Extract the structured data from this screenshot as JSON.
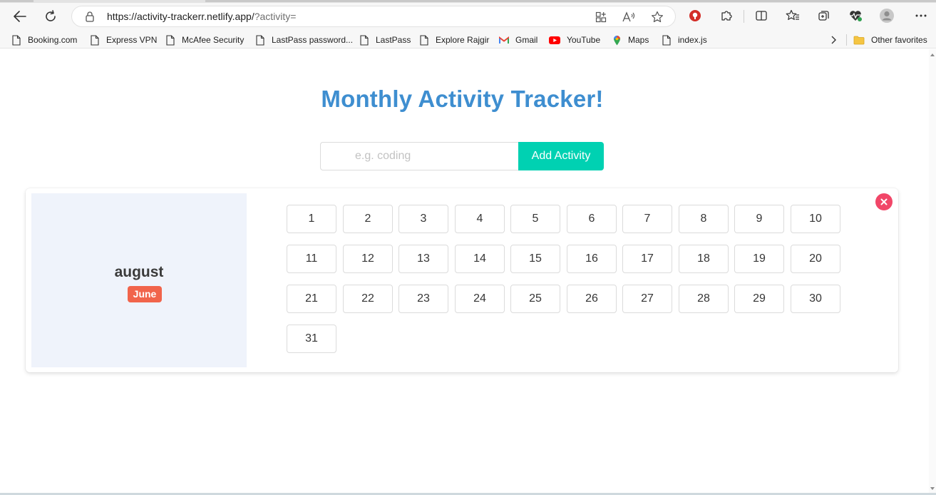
{
  "browser": {
    "url_main": "https://activity-trackerr.netlify.app/",
    "url_query": "?activity=",
    "icons": {
      "back": "back-arrow-icon",
      "refresh": "refresh-icon",
      "lock": "lock-icon",
      "apps": "apps-icon",
      "read_aloud": "read-aloud-icon",
      "favorite": "star-icon",
      "extensions": "puzzle-icon",
      "split": "split-screen-icon",
      "favorites": "favorites-icon",
      "collections": "collections-icon",
      "health": "heartbeat-icon",
      "profile": "avatar-icon",
      "menu": "more-icon"
    }
  },
  "bookmarks": {
    "items": [
      {
        "label": "Booking.com",
        "icon": "page-icon"
      },
      {
        "label": "Express VPN",
        "icon": "page-icon"
      },
      {
        "label": "McAfee Security",
        "icon": "page-icon"
      },
      {
        "label": "LastPass password...",
        "icon": "page-icon"
      },
      {
        "label": "LastPass",
        "icon": "page-icon"
      },
      {
        "label": "Explore Rajgir",
        "icon": "page-icon"
      },
      {
        "label": "Gmail",
        "icon": "gmail-icon"
      },
      {
        "label": "YouTube",
        "icon": "youtube-icon"
      },
      {
        "label": "Maps",
        "icon": "maps-icon"
      },
      {
        "label": "index.js",
        "icon": "page-icon"
      }
    ],
    "other_favorites": "Other favorites"
  },
  "page": {
    "title": "Monthly Activity Tracker!",
    "input_placeholder": "e.g. coding",
    "input_value": "",
    "add_button": "Add Activity"
  },
  "activity": {
    "name": "august",
    "month": "June",
    "days": [
      "1",
      "2",
      "3",
      "4",
      "5",
      "6",
      "7",
      "8",
      "9",
      "10",
      "11",
      "12",
      "13",
      "14",
      "15",
      "16",
      "17",
      "18",
      "19",
      "20",
      "21",
      "22",
      "23",
      "24",
      "25",
      "26",
      "27",
      "28",
      "29",
      "30",
      "31"
    ]
  },
  "colors": {
    "title": "#3e8ed0",
    "primary_button": "#00d1b2",
    "month_tag": "#f1644b",
    "delete": "#f14668",
    "card_side": "#eff3fb"
  }
}
